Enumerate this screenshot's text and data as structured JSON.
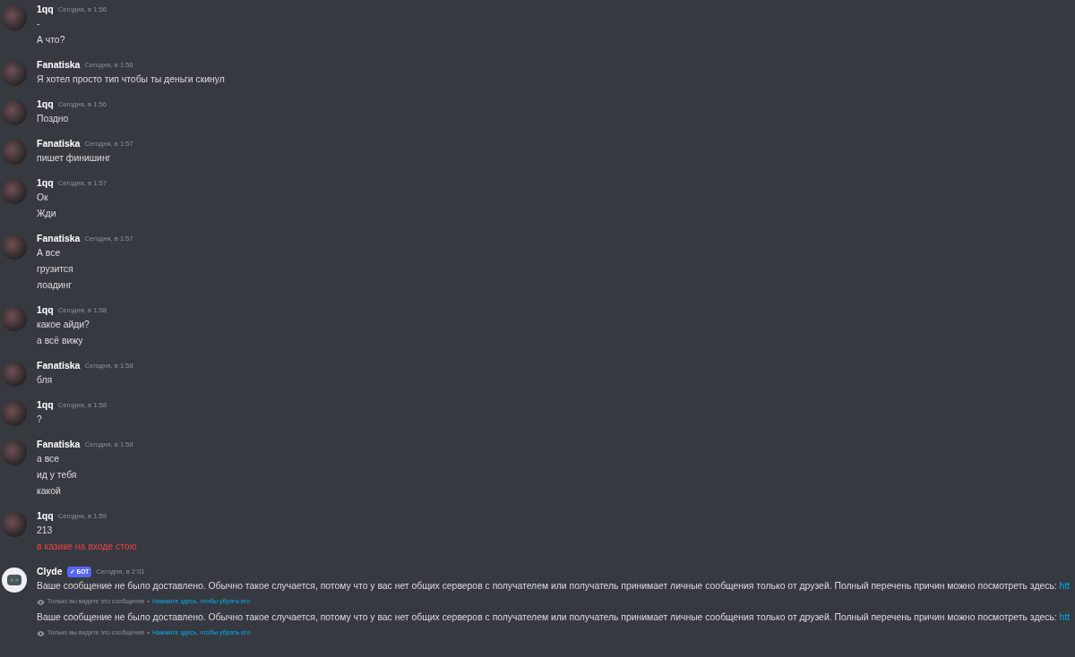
{
  "messages": [
    {
      "author": "1qq",
      "time": "Сегодня, в 1:56",
      "lines": [
        {
          "text": "-",
          "failed": false
        },
        {
          "text": "А что?",
          "failed": false
        }
      ]
    },
    {
      "author": "Fanatiska",
      "time": "Сегодня, в 1:56",
      "lines": [
        {
          "text": "Я хотел просто тип чтобы ты деньги скинул",
          "failed": false
        }
      ]
    },
    {
      "author": "1qq",
      "time": "Сегодня, в 1:56",
      "lines": [
        {
          "text": "Поздно",
          "failed": false
        }
      ]
    },
    {
      "author": "Fanatiska",
      "time": "Сегодня, в 1:57",
      "lines": [
        {
          "text": "пишет финишинг",
          "failed": false
        }
      ]
    },
    {
      "author": "1qq",
      "time": "Сегодня, в 1:57",
      "lines": [
        {
          "text": "Ок",
          "failed": false
        },
        {
          "text": "Жди",
          "failed": false
        }
      ]
    },
    {
      "author": "Fanatiska",
      "time": "Сегодня, в 1:57",
      "lines": [
        {
          "text": "А все",
          "failed": false
        },
        {
          "text": "грузится",
          "failed": false
        },
        {
          "text": "лоадинг",
          "failed": false
        }
      ]
    },
    {
      "author": "1qq",
      "time": "Сегодня, в 1:58",
      "lines": [
        {
          "text": "какое айди?",
          "failed": false
        },
        {
          "text": "а всё вижу",
          "failed": false
        }
      ]
    },
    {
      "author": "Fanatiska",
      "time": "Сегодня, в 1:58",
      "lines": [
        {
          "text": "бля",
          "failed": false
        }
      ]
    },
    {
      "author": "1qq",
      "time": "Сегодня, в 1:58",
      "lines": [
        {
          "text": "?",
          "failed": false
        }
      ]
    },
    {
      "author": "Fanatiska",
      "time": "Сегодня, в 1:58",
      "lines": [
        {
          "text": "а все",
          "failed": false
        },
        {
          "text": "ид у тебя",
          "failed": false
        },
        {
          "text": "какой",
          "failed": false
        }
      ]
    },
    {
      "author": "1qq",
      "time": "Сегодня, в 1:59",
      "lines": [
        {
          "text": "213",
          "failed": false
        },
        {
          "text": "в казике на входе стою",
          "failed": true
        }
      ]
    },
    {
      "author": "Clyde",
      "bot_tag": "✓ БОТ",
      "time": "Сегодня, в 2:01",
      "lines": [
        {
          "text": "Ваше сообщение не было доставлено. Обычно такое случается, потому что у вас нет общих серверов с получателем или получатель принимает личные сообщения только от друзей. Полный перечень причин можно посмотреть здесь:",
          "link": "htt",
          "failed": false,
          "note": "Только вы видите это сообщение",
          "note_sep": "•",
          "note_link": "Нажмите здесь, чтобы убрать его"
        },
        {
          "text": "Ваше сообщение не было доставлено. Обычно такое случается, потому что у вас нет общих серверов с получателем или получатель принимает личные сообщения только от друзей. Полный перечень причин можно посмотреть здесь:",
          "link": "htt",
          "failed": false,
          "note": "Только вы видите это сообщение",
          "note_sep": "•",
          "note_link": "Нажмите здесь, чтобы убрать его"
        }
      ]
    }
  ]
}
